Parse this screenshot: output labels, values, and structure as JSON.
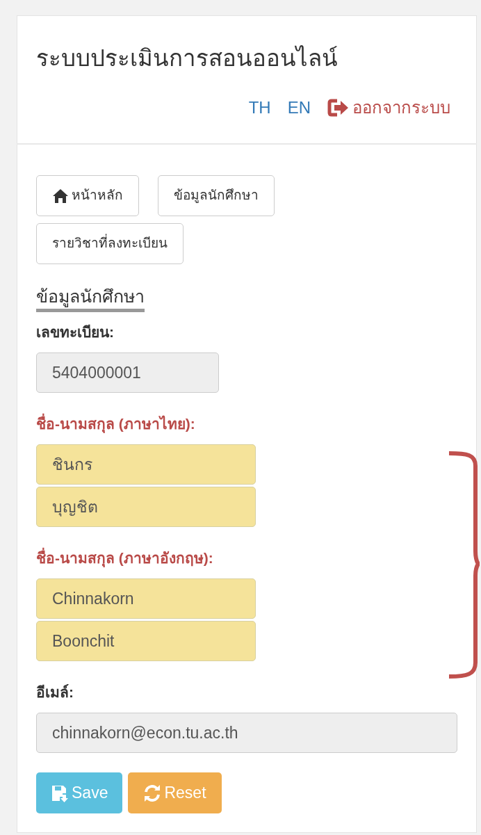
{
  "header": {
    "title": "ระบบประเมินการสอนออนไลน์",
    "languages": [
      {
        "label": "TH"
      },
      {
        "label": "EN"
      }
    ],
    "logout": "ออกจากระบบ"
  },
  "nav_buttons": [
    {
      "label": "หน้าหลัก",
      "kind": "home"
    },
    {
      "label": "ข้อมูลนักศึกษา",
      "kind": "plain"
    },
    {
      "label": "รายวิชาที่ลงทะเบียน",
      "kind": "plain"
    }
  ],
  "section_title": "ข้อมูลนักศึกษา",
  "fields": [
    {
      "label": "เลขทะเบียน:",
      "required": false,
      "inputs": [
        {
          "value": "5404000001",
          "kind": "readonly"
        }
      ]
    },
    {
      "label": "ชื่อ-นามสกุล (ภาษาไทย):",
      "required": true,
      "inputs": [
        {
          "value": "ชินกร",
          "kind": "highlighted"
        },
        {
          "value": "บุญชิต",
          "kind": "highlighted"
        }
      ]
    },
    {
      "label": "ชื่อ-นามสกุล (ภาษาอังกฤษ):",
      "required": true,
      "inputs": [
        {
          "value": "Chinnakorn",
          "kind": "highlighted"
        },
        {
          "value": "Boonchit",
          "kind": "highlighted"
        }
      ]
    },
    {
      "label": "อีเมล์:",
      "required": false,
      "inputs": [
        {
          "value": "chinnakorn@econ.tu.ac.th",
          "kind": "readonly"
        }
      ]
    }
  ],
  "actions": [
    {
      "label": "Save",
      "kind": "save"
    },
    {
      "label": "Reset",
      "kind": "reset"
    }
  ]
}
